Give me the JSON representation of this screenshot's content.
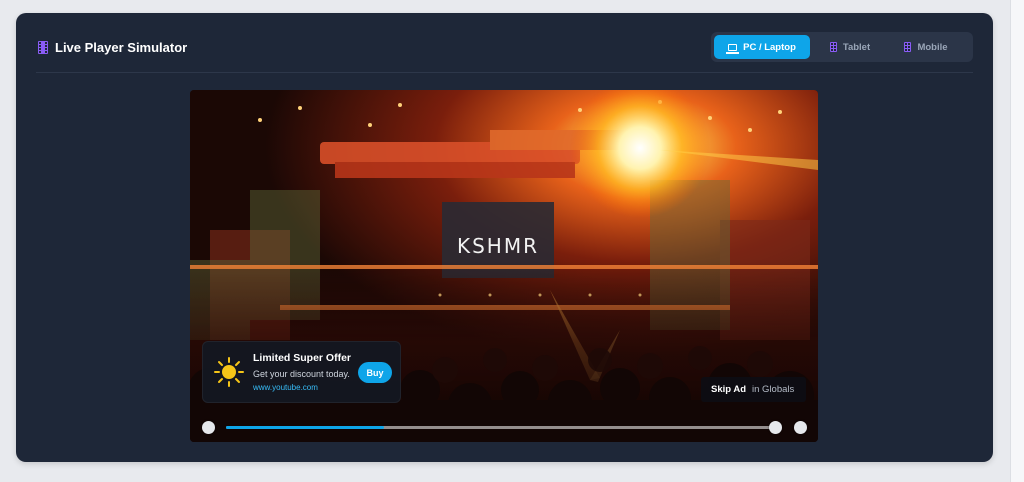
{
  "header": {
    "title": "Live Player Simulator",
    "title_icon": "film-icon"
  },
  "device_tabs": [
    {
      "label": "PC / Laptop",
      "icon": "laptop-icon",
      "active": true
    },
    {
      "label": "Tablet",
      "icon": "film-icon",
      "active": false
    },
    {
      "label": "Mobile",
      "icon": "film-icon",
      "active": false
    }
  ],
  "player": {
    "stage_text": "KSHMR",
    "ad": {
      "title": "Limited Super Offer",
      "subtitle": "Get your discount today.",
      "url": "www.youtube.com",
      "cta": "Buy",
      "icon": "sun-icon"
    },
    "skip": {
      "label": "Skip Ad",
      "suffix": "in Globals"
    },
    "progress": 0.29
  },
  "colors": {
    "accent": "#0ea5e9",
    "card_bg": "#1e2738",
    "tab_group_bg": "#2b3548",
    "icon_purple": "#8a5cf6"
  }
}
